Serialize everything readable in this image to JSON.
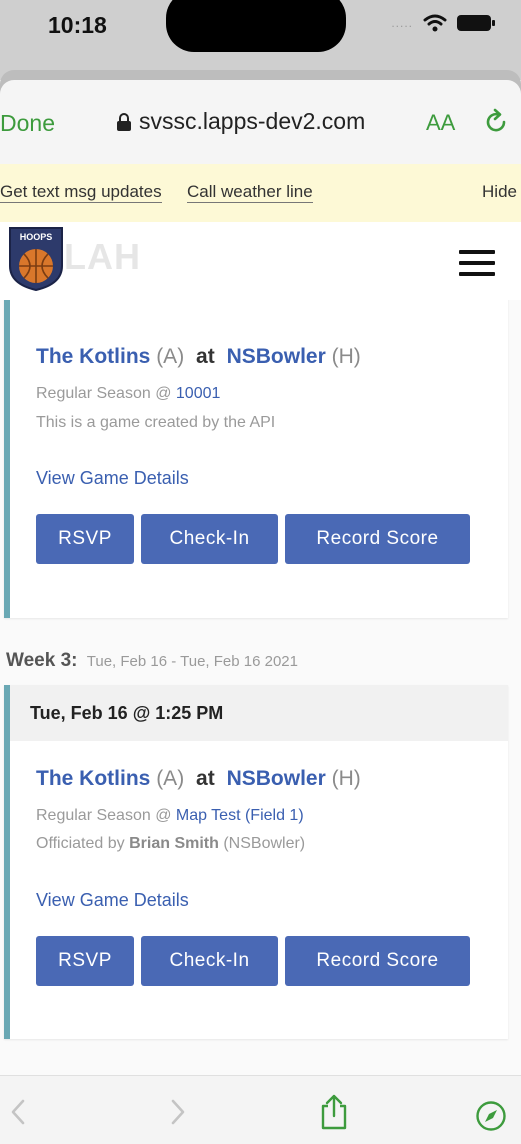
{
  "status_bar": {
    "time": "10:18",
    "signal": "....."
  },
  "browser": {
    "done_label": "Done",
    "url": "svssc.lapps-dev2.com",
    "text_size_label": "AA",
    "accent_color": "#3d9b3d"
  },
  "banner": {
    "text_updates_label": "Get text msg updates",
    "weather_label": "Call weather line",
    "hide_label": "Hide"
  },
  "site": {
    "logo_badge_text": "HOOPS",
    "logo_name": "LAH"
  },
  "games": [
    {
      "team_away": "The Kotlins",
      "team_away_tag": "(A)",
      "at": "at",
      "team_home": "NSBowler",
      "team_home_tag": "(H)",
      "season_prefix": "Regular Season @",
      "location": "10001",
      "note": "This is a game created by the API",
      "details_label": "View Game Details",
      "rsvp_label": "RSVP",
      "checkin_label": "Check-In",
      "record_label": "Record Score"
    },
    {
      "header": "Tue, Feb 16 @ 1:25 PM",
      "team_away": "The Kotlins",
      "team_away_tag": "(A)",
      "at": "at",
      "team_home": "NSBowler",
      "team_home_tag": "(H)",
      "season_prefix": "Regular Season @",
      "location": "Map Test (Field 1)",
      "officiated_prefix": "Officiated by",
      "official_name": "Brian Smith",
      "official_team": "(NSBowler)",
      "details_label": "View Game Details",
      "rsvp_label": "RSVP",
      "checkin_label": "Check-In",
      "record_label": "Record Score"
    }
  ],
  "weeks": [
    {
      "label": "Week 3:",
      "range": "Tue, Feb 16 - Tue, Feb 16 2021"
    }
  ],
  "colors": {
    "link": "#3a5fb0",
    "button": "#4a69b5",
    "card_accent": "#6aa8b4",
    "banner_bg": "#fdf9d6"
  },
  "toolbar": {
    "icons": [
      "back-icon",
      "forward-icon",
      "share-icon",
      "compass-icon"
    ]
  }
}
